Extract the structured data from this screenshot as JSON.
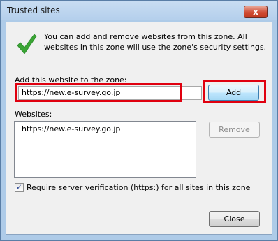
{
  "window": {
    "title": "Trusted sites",
    "close_glyph": "x"
  },
  "intro_text": "You can add and remove websites from this zone. All websites in this zone will use the zone's security settings.",
  "add_section": {
    "label": "Add this website to the zone:",
    "input_value": "https://new.e-survey.go.jp",
    "add_button": "Add"
  },
  "websites": {
    "label": "Websites:",
    "items": [
      "https://new.e-survey.go.jp"
    ],
    "remove_button": "Remove"
  },
  "require_verification": {
    "checked": true,
    "check_glyph": "✓",
    "label": "Require server verification (https:) for all sites in this zone"
  },
  "close_button": "Close",
  "colors": {
    "highlight": "#e0000f",
    "check_green": "#3aa534"
  }
}
